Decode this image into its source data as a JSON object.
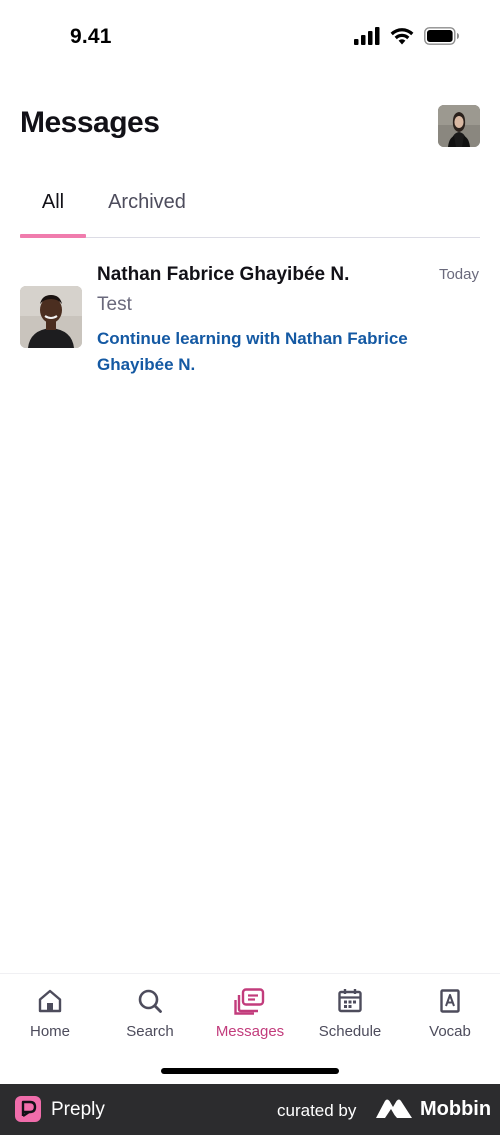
{
  "status_bar": {
    "time": "9.41"
  },
  "header": {
    "title": "Messages"
  },
  "tabs": [
    {
      "label": "All",
      "active": true
    },
    {
      "label": "Archived",
      "active": false
    }
  ],
  "conversations": [
    {
      "name": "Nathan Fabrice Ghayibée N.",
      "date": "Today",
      "preview": "Test",
      "cta": "Continue learning with Nathan Fabrice Ghayibée N."
    }
  ],
  "bottom_nav": [
    {
      "label": "Home",
      "icon": "home-icon",
      "active": false
    },
    {
      "label": "Search",
      "icon": "search-icon",
      "active": false
    },
    {
      "label": "Messages",
      "icon": "messages-icon",
      "active": true
    },
    {
      "label": "Schedule",
      "icon": "calendar-icon",
      "active": false
    },
    {
      "label": "Vocab",
      "icon": "vocab-icon",
      "active": false
    }
  ],
  "footer": {
    "brand": "Preply",
    "curated_by": "curated by",
    "curator": "Mobbin"
  },
  "colors": {
    "accent_pink": "#f07cad",
    "active_nav": "#c23c7c",
    "link_blue": "#1459a3"
  }
}
